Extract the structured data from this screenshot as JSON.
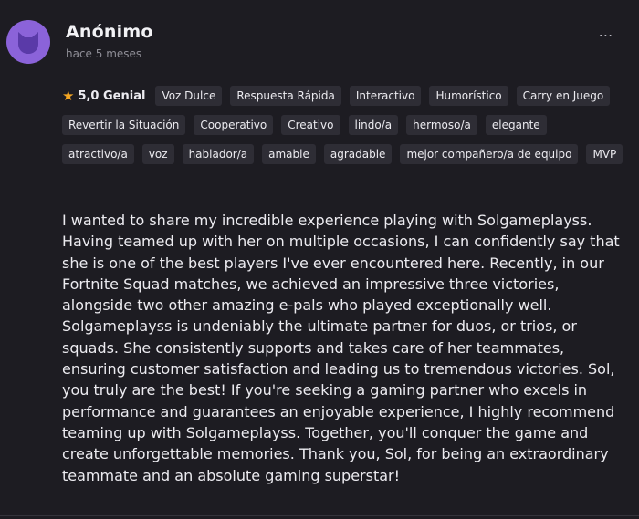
{
  "review": {
    "author": "Anónimo",
    "time_ago": "hace 5 meses",
    "more_icon": "⋯",
    "rating": {
      "icon": "star-icon",
      "text": "5,0 Genial"
    },
    "tags": [
      "Voz Dulce",
      "Respuesta Rápida",
      "Interactivo",
      "Humorístico",
      "Carry en Juego",
      "Revertir la Situación",
      "Cooperativo",
      "Creativo",
      "lindo/a",
      "hermoso/a",
      "elegante",
      "atractivo/a",
      "voz",
      "hablador/a",
      "amable",
      "agradable",
      "mejor compañero/a de equipo",
      "MVP"
    ],
    "body": "I wanted to share my incredible experience playing with Solgameplayss. Having teamed up with her on multiple occasions, I can confidently say that she is one of the best players I've ever encountered here. Recently, in our Fortnite Squad matches, we achieved an impressive three victories, alongside two other amazing e-pals who played exceptionally well. Solgameplayss is undeniably the ultimate partner for duos, or trios, or squads. She consistently supports and takes care of her teammates, ensuring customer satisfaction and leading us to tremendous victories. Sol, you truly are the best! If you're seeking a gaming partner who excels in performance and guarantees an enjoyable experience, I highly recommend teaming up with Solgameplayss. Together, you'll conquer the game and create unforgettable memories. Thank you, Sol, for being an extraordinary teammate and an absolute gaming superstar!"
  },
  "colors": {
    "background": "#1d1c22",
    "tag_bg": "#2e2d35",
    "avatar_bg": "#8b63d9",
    "star": "#f5a623"
  }
}
